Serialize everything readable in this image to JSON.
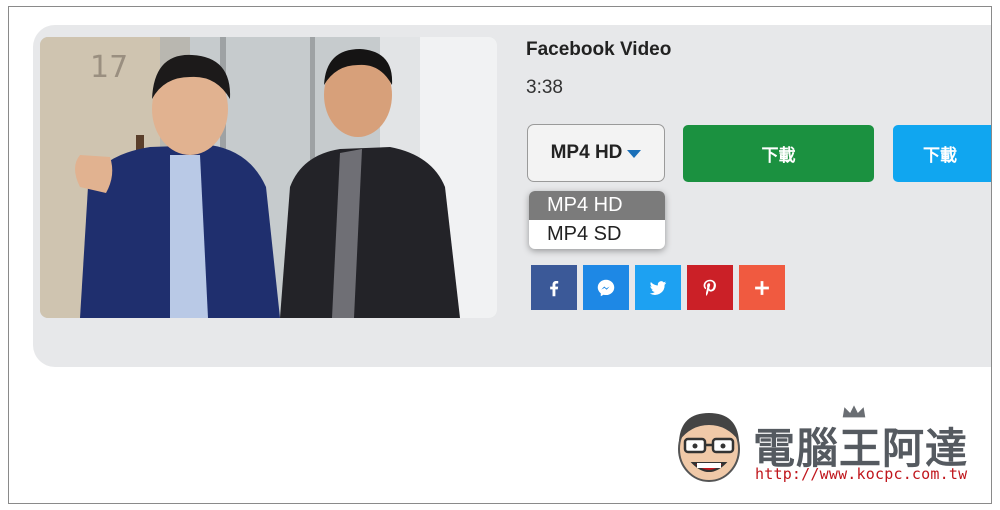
{
  "video": {
    "title": "Facebook Video",
    "duration": "3:38"
  },
  "format_select": {
    "selected": "MP4 HD",
    "options": [
      "MP4 HD",
      "MP4 SD"
    ]
  },
  "buttons": {
    "download_primary": "下載",
    "download_secondary": "下載"
  },
  "share": [
    {
      "name": "facebook",
      "icon": "facebook-icon",
      "color": "#3b5998"
    },
    {
      "name": "messenger",
      "icon": "messenger-icon",
      "color": "#1e88e5"
    },
    {
      "name": "twitter",
      "icon": "twitter-icon",
      "color": "#1da1f2"
    },
    {
      "name": "pinterest",
      "icon": "pinterest-icon",
      "color": "#cb2027"
    },
    {
      "name": "more",
      "icon": "plus-icon",
      "color": "#f05a40"
    }
  ],
  "watermark": {
    "title": "電腦王阿達",
    "url": "http://www.kocpc.com.tw"
  },
  "colors": {
    "card_bg": "#e7e8ea",
    "download_green": "#1b9140",
    "download_blue": "#10a6f0",
    "caret_blue": "#1a6fb8"
  }
}
